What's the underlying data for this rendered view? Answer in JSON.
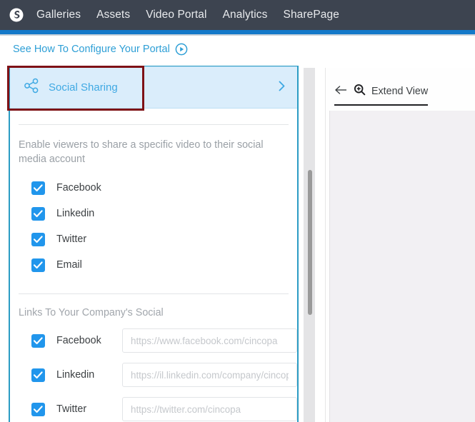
{
  "topnav": {
    "logo_icon": "cincopa-s-logo-icon",
    "items": [
      {
        "label": "Galleries"
      },
      {
        "label": "Assets"
      },
      {
        "label": "Video Portal"
      },
      {
        "label": "Analytics"
      },
      {
        "label": "SharePage"
      }
    ],
    "bg_color": "#3d4450",
    "accent_bar_color": "#1479c9"
  },
  "configure": {
    "link_text": "See How To Configure Your Portal",
    "play_icon": "play-circle-icon",
    "link_color": "#2e9fd6"
  },
  "panel": {
    "header": {
      "title": "Social Sharing",
      "icon": "share-nodes-icon",
      "chevron_icon": "chevron-right-icon",
      "bg_color": "#daedfb",
      "text_color": "#3fa9e3"
    },
    "description": "Enable viewers to share a specific video to their social media account",
    "share_options": [
      {
        "label": "Facebook",
        "checked": true
      },
      {
        "label": "Linkedin",
        "checked": true
      },
      {
        "label": "Twitter",
        "checked": true
      },
      {
        "label": "Email",
        "checked": true
      }
    ],
    "links_section": {
      "title": "Links To Your Company's Social",
      "rows": [
        {
          "label": "Facebook",
          "checked": true,
          "value": "",
          "placeholder": "https://www.facebook.com/cincopa"
        },
        {
          "label": "Linkedin",
          "checked": true,
          "value": "",
          "placeholder": "https://il.linkedin.com/company/cincopa"
        },
        {
          "label": "Twitter",
          "checked": true,
          "value": "",
          "placeholder": "https://twitter.com/cincopa"
        }
      ]
    },
    "checkbox_color": "#2196ec",
    "border_color": "#2b9cc4"
  },
  "annotation": {
    "highlight_box_color": "#7e1116"
  },
  "scrollbar": {
    "track_color": "#e4e4e6",
    "thumb_color": "#9a9a9a"
  },
  "preview": {
    "back_icon": "arrow-left-icon",
    "zoom_icon": "magnifier-plus-icon",
    "label": "Extend View",
    "canvas_color": "#f2f0f3"
  }
}
